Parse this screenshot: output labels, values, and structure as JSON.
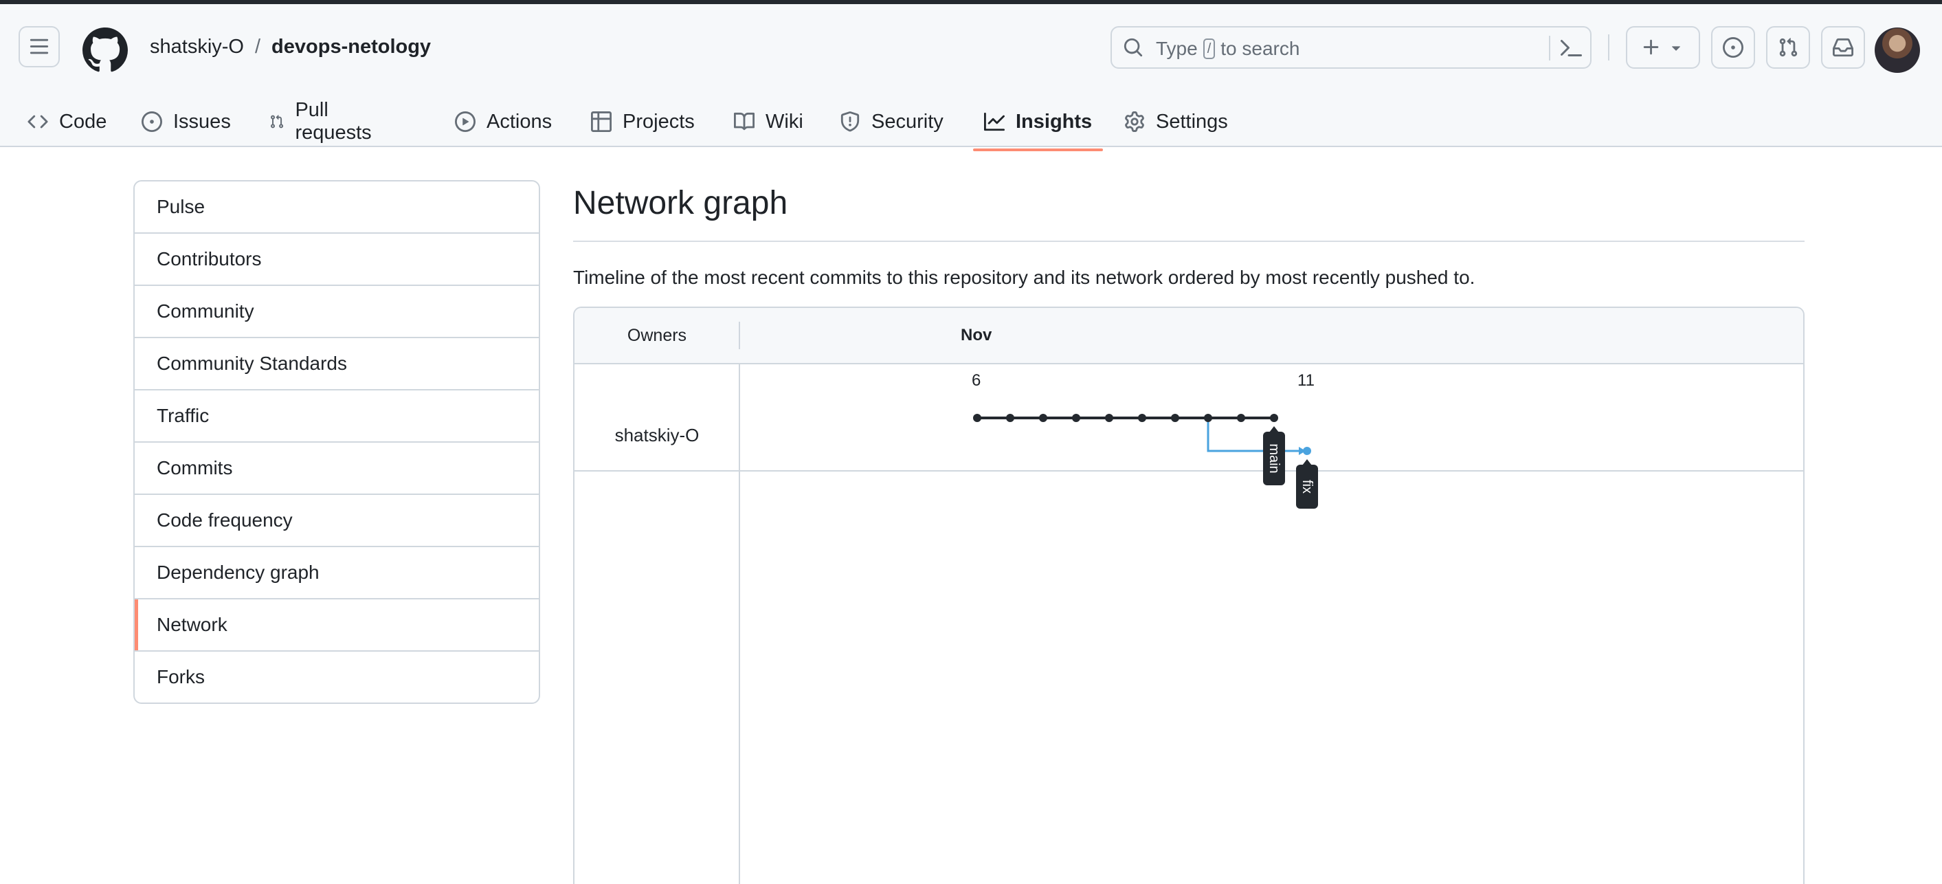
{
  "header": {
    "owner": "shatskiy-O",
    "separator": "/",
    "repo": "devops-netology",
    "search": {
      "prefix": "Type",
      "key": "/",
      "suffix": "to search"
    }
  },
  "tabs": [
    {
      "label": "Code",
      "icon": "code-icon"
    },
    {
      "label": "Issues",
      "icon": "issue-opened-icon"
    },
    {
      "label": "Pull requests",
      "icon": "git-pull-request-icon"
    },
    {
      "label": "Actions",
      "icon": "play-icon"
    },
    {
      "label": "Projects",
      "icon": "table-icon"
    },
    {
      "label": "Wiki",
      "icon": "book-icon"
    },
    {
      "label": "Security",
      "icon": "shield-icon"
    },
    {
      "label": "Insights",
      "icon": "graph-icon",
      "active": true
    },
    {
      "label": "Settings",
      "icon": "gear-icon"
    }
  ],
  "sidebar": {
    "items": [
      {
        "label": "Pulse"
      },
      {
        "label": "Contributors"
      },
      {
        "label": "Community"
      },
      {
        "label": "Community Standards"
      },
      {
        "label": "Traffic"
      },
      {
        "label": "Commits"
      },
      {
        "label": "Code frequency"
      },
      {
        "label": "Dependency graph"
      },
      {
        "label": "Network",
        "selected": true
      },
      {
        "label": "Forks"
      }
    ]
  },
  "main": {
    "title": "Network graph",
    "description": "Timeline of the most recent commits to this repository and its network ordered by most recently pushed to."
  },
  "network": {
    "owners_header": "Owners",
    "month": "Nov",
    "day_labels": [
      "6",
      "11"
    ],
    "owner": "shatskiy-O",
    "main_branch": {
      "label": "main",
      "commit_count": 10,
      "color": "#24292f"
    },
    "fix_branch": {
      "label": "fix",
      "commit_count": 1,
      "branch_from_commit": 8,
      "color": "#4aa3df"
    }
  },
  "colors": {
    "accent": "#fd8c73",
    "border": "#d0d7de",
    "main_line": "#24292f",
    "fix_line": "#4aa3df"
  }
}
